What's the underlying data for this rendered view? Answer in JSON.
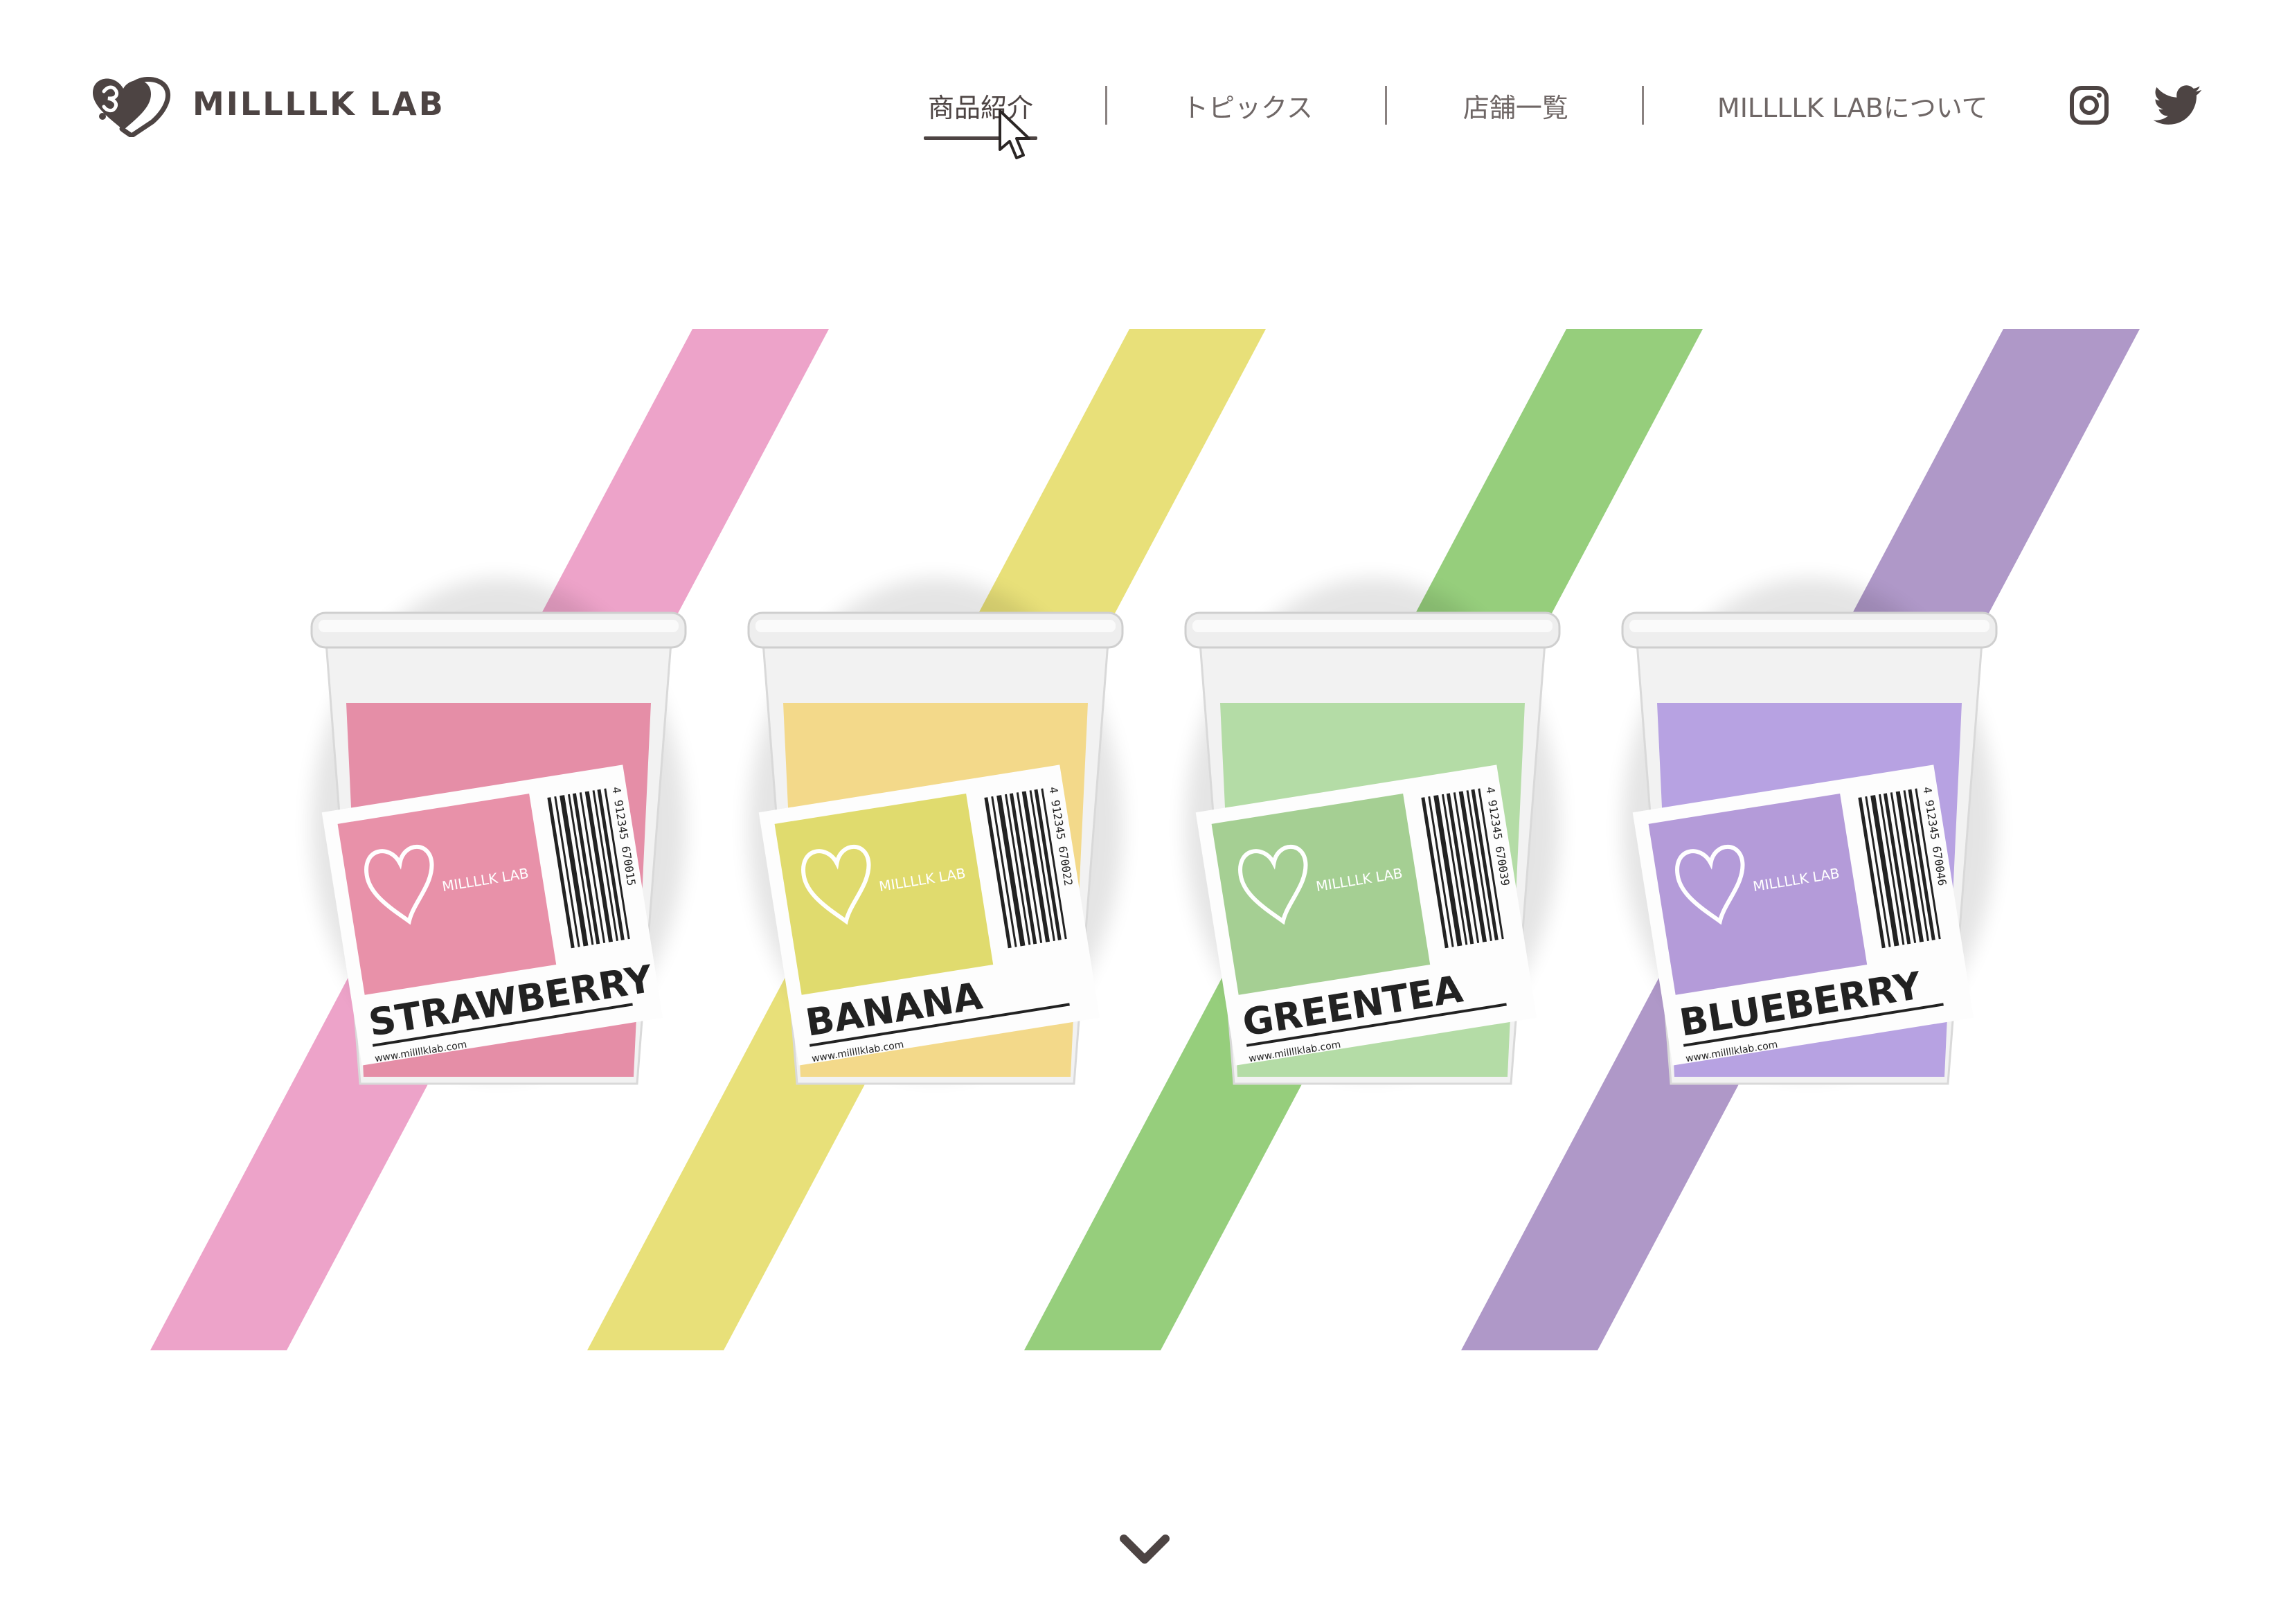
{
  "brand": {
    "name": "MILLLLK LAB",
    "text_color": "#4d4443"
  },
  "nav": {
    "items": [
      {
        "label": "商品紹介",
        "active": true
      },
      {
        "label": "トピックス",
        "active": false
      },
      {
        "label": "店舗一覧",
        "active": false
      },
      {
        "label": "MILLLLK LABについて",
        "active": false
      }
    ],
    "social": [
      {
        "name": "instagram-icon"
      },
      {
        "name": "twitter-icon"
      }
    ]
  },
  "hero": {
    "products": [
      {
        "flavor": "STRAWBERRY",
        "brand": "MILLLLK LAB",
        "url": "www.millllklab.com",
        "barcode": "4 912345 670015",
        "stripe_color": "#eda3c9",
        "drink_color": "#e58ea7",
        "label_color": "#e891a9"
      },
      {
        "flavor": "BANANA",
        "brand": "MILLLLK LAB",
        "url": "www.millllklab.com",
        "barcode": "4 912345 670022",
        "stripe_color": "#e8e079",
        "drink_color": "#f3d98a",
        "label_color": "#e0db6e"
      },
      {
        "flavor": "GREENTEA",
        "brand": "MILLLLK LAB",
        "url": "www.millllklab.com",
        "barcode": "4 912345 670039",
        "stripe_color": "#96ce7c",
        "drink_color": "#b4dca6",
        "label_color": "#a5cf93"
      },
      {
        "flavor": "BLUEBERRY",
        "brand": "MILLLLK LAB",
        "url": "www.millllklab.com",
        "barcode": "4 912345 670046",
        "stripe_color": "#af98c8",
        "drink_color": "#b7a2e2",
        "label_color": "#b49bd9"
      }
    ],
    "scroll_icon": "chevron-down-icon"
  }
}
